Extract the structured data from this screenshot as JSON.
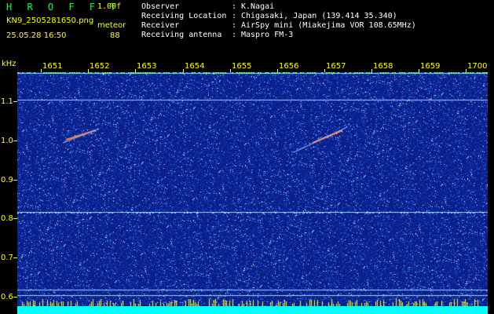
{
  "header": {
    "app_title": "H R O F F T",
    "version": "1.00f",
    "filename": "KN9_2505281650.png",
    "meteor_label": "meteor",
    "datetime": "25.05.28 16:50",
    "meteor_count": "88"
  },
  "info": [
    {
      "label": "Observer",
      "sep": ":",
      "value": "K.Nagai"
    },
    {
      "label": "Receiving Location",
      "sep": ":",
      "value": "Chigasaki, Japan (139.414 35.340)"
    },
    {
      "label": "Receiver",
      "sep": ":",
      "value": "AirSpy mini (Miakejima VOR 108.65MHz)"
    },
    {
      "label": "Receiving antenna",
      "sep": ":",
      "value": "Maspro FM-3"
    }
  ],
  "axis": {
    "freq_unit": "kHz",
    "time_ticks": [
      "1651",
      "1652",
      "1653",
      "1654",
      "1655",
      "1656",
      "1657",
      "1658",
      "1659",
      "1700"
    ],
    "freq_ticks": [
      "1.1",
      "1.0",
      "0.9",
      "0.8",
      "0.7",
      "0.6"
    ]
  },
  "colors": {
    "background": "#000000",
    "label": "#ffff00",
    "title": "#00ff40",
    "plot_bg": "#0b1f8a",
    "grid_line": "#ffffff",
    "bottom_bar": "#00ffff"
  }
}
